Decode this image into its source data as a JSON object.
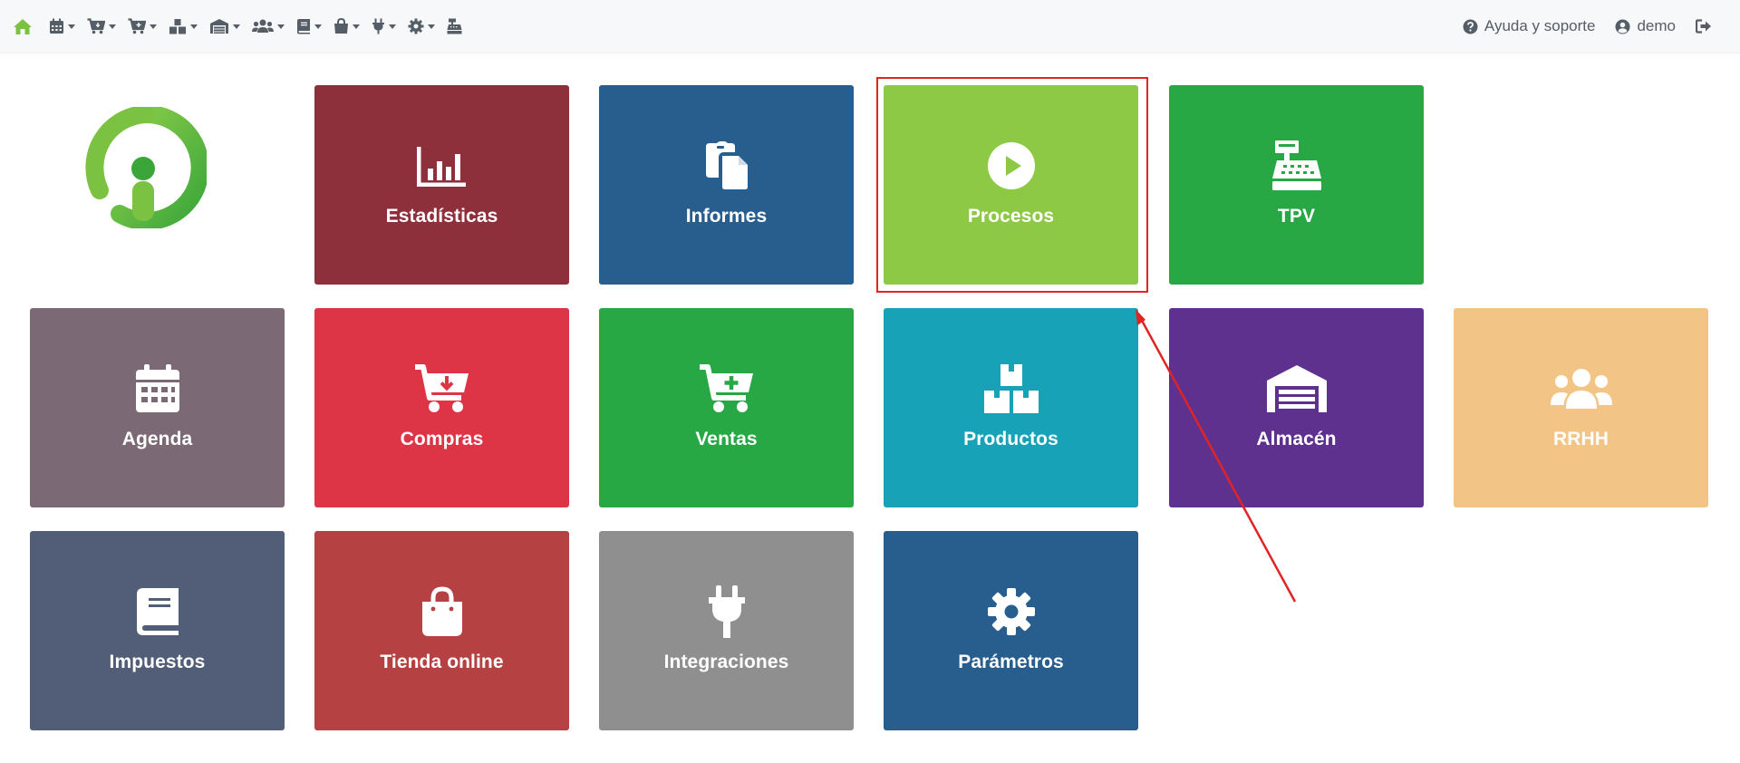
{
  "nav": {
    "home_icon": "home-icon",
    "menus": [
      {
        "name": "agenda-menu",
        "icon": "calendar-icon"
      },
      {
        "name": "compras-menu",
        "icon": "cart-download-icon"
      },
      {
        "name": "ventas-menu",
        "icon": "cart-plus-icon"
      },
      {
        "name": "productos-menu",
        "icon": "boxes-icon"
      },
      {
        "name": "almacen-menu",
        "icon": "warehouse-icon"
      },
      {
        "name": "rrhh-menu",
        "icon": "users-icon"
      },
      {
        "name": "impuestos-menu",
        "icon": "book-icon"
      },
      {
        "name": "tienda-menu",
        "icon": "shopping-bag-icon"
      },
      {
        "name": "integraciones-menu",
        "icon": "plug-icon"
      },
      {
        "name": "parametros-menu",
        "icon": "cog-icon"
      }
    ],
    "tpv_icon": "cash-register-icon",
    "help_label": "Ayuda y soporte",
    "user_label": "demo"
  },
  "tiles": {
    "estadisticas": {
      "label": "Estadísticas",
      "color": "#8e303b",
      "icon": "chart-bar-icon"
    },
    "informes": {
      "label": "Informes",
      "color": "#285e8e",
      "icon": "copy-icon"
    },
    "procesos": {
      "label": "Procesos",
      "color": "#8dc944",
      "icon": "play-circle-icon"
    },
    "tpv": {
      "label": "TPV",
      "color": "#28a745",
      "icon": "cash-register-icon"
    },
    "agenda": {
      "label": "Agenda",
      "color": "#7b6a75",
      "icon": "calendar-icon"
    },
    "compras": {
      "label": "Compras",
      "color": "#dd3546",
      "icon": "cart-download-icon"
    },
    "ventas": {
      "label": "Ventas",
      "color": "#28a745",
      "icon": "cart-plus-icon"
    },
    "productos": {
      "label": "Productos",
      "color": "#18a2b8",
      "icon": "boxes-icon"
    },
    "almacen": {
      "label": "Almacén",
      "color": "#5e318f",
      "icon": "warehouse-icon"
    },
    "rrhh": {
      "label": "RRHH",
      "color": "#f2c586",
      "icon": "users-icon"
    },
    "impuestos": {
      "label": "Impuestos",
      "color": "#525e78",
      "icon": "book-icon"
    },
    "tienda": {
      "label": "Tienda online",
      "color": "#b54143",
      "icon": "shopping-bag-icon"
    },
    "integraciones": {
      "label": "Integraciones",
      "color": "#8f8f8f",
      "icon": "plug-icon"
    },
    "parametros": {
      "label": "Parámetros",
      "color": "#285e8e",
      "icon": "cog-icon"
    }
  },
  "annotation": {
    "highlighted_tile": "Procesos",
    "box_color": "#e02424",
    "arrow_color": "#e02424"
  }
}
